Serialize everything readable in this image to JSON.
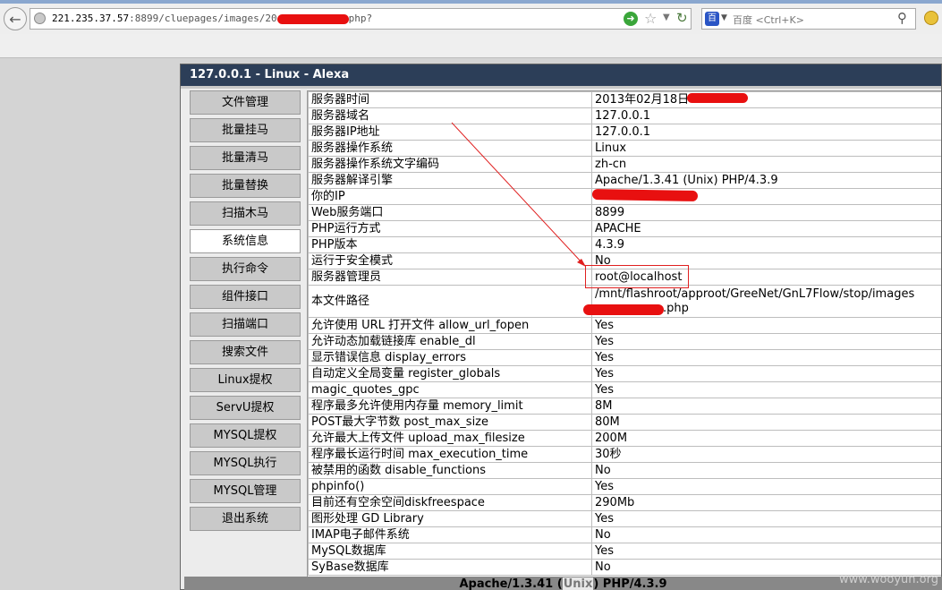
{
  "browser": {
    "url_host": "221.235.37.57",
    "url_rest_before": ":8899/cluepages/images/20",
    "url_rest_after": "php?",
    "search_placeholder": "百度 <Ctrl+K>",
    "search_engine_label": "百",
    "icons": {
      "back": "back-arrow-icon",
      "go": "go-arrow-icon",
      "bookmark": "star-icon",
      "reload": "reload-icon",
      "search": "magnifier-icon"
    }
  },
  "panel": {
    "title": "127.0.0.1 - Linux - Alexa"
  },
  "nav": [
    {
      "label": "文件管理",
      "active": false
    },
    {
      "label": "批量挂马",
      "active": false
    },
    {
      "label": "批量清马",
      "active": false
    },
    {
      "label": "批量替换",
      "active": false
    },
    {
      "label": "扫描木马",
      "active": false
    },
    {
      "label": "系统信息",
      "active": true
    },
    {
      "label": "执行命令",
      "active": false
    },
    {
      "label": "组件接口",
      "active": false
    },
    {
      "label": "扫描端口",
      "active": false
    },
    {
      "label": "搜索文件",
      "active": false
    },
    {
      "label": "Linux提权",
      "active": false
    },
    {
      "label": "ServU提权",
      "active": false
    },
    {
      "label": "MYSQL提权",
      "active": false
    },
    {
      "label": "MYSQL执行",
      "active": false
    },
    {
      "label": "MYSQL管理",
      "active": false
    },
    {
      "label": "退出系统",
      "active": false
    }
  ],
  "info": [
    {
      "k": "服务器时间",
      "v": "2013年02月18日"
    },
    {
      "k": "服务器域名",
      "v": "127.0.0.1"
    },
    {
      "k": "服务器IP地址",
      "v": "127.0.0.1"
    },
    {
      "k": "服务器操作系统",
      "v": "Linux"
    },
    {
      "k": "服务器操作系统文字编码",
      "v": "zh-cn"
    },
    {
      "k": "服务器解译引擎",
      "v": "Apache/1.3.41 (Unix) PHP/4.3.9"
    },
    {
      "k": "你的IP",
      "v": ""
    },
    {
      "k": "Web服务端口",
      "v": "8899"
    },
    {
      "k": "PHP运行方式",
      "v": "APACHE"
    },
    {
      "k": "PHP版本",
      "v": "4.3.9"
    },
    {
      "k": "运行于安全模式",
      "v": "No"
    },
    {
      "k": "服务器管理员",
      "v": "root@localhost"
    },
    {
      "k": "本文件路径",
      "v": "/mnt/flashroot/approot/GreeNet/GnL7Flow/stop/images",
      "v2": ".php"
    },
    {
      "k": "允许使用 URL 打开文件 allow_url_fopen",
      "v": "Yes"
    },
    {
      "k": "允许动态加载链接库 enable_dl",
      "v": "Yes"
    },
    {
      "k": "显示错误信息 display_errors",
      "v": "Yes"
    },
    {
      "k": "自动定义全局变量 register_globals",
      "v": "Yes"
    },
    {
      "k": "magic_quotes_gpc",
      "v": "Yes"
    },
    {
      "k": "程序最多允许使用内存量 memory_limit",
      "v": "8M"
    },
    {
      "k": "POST最大字节数 post_max_size",
      "v": "80M"
    },
    {
      "k": "允许最大上传文件 upload_max_filesize",
      "v": "200M"
    },
    {
      "k": "程序最长运行时间 max_execution_time",
      "v": "30秒"
    },
    {
      "k": "被禁用的函数 disable_functions",
      "v": "No"
    },
    {
      "k": "phpinfo()",
      "v": "Yes"
    },
    {
      "k": "目前还有空余空间diskfreespace",
      "v": "290Mb"
    },
    {
      "k": "图形处理 GD Library",
      "v": "Yes"
    },
    {
      "k": "IMAP电子邮件系统",
      "v": "No"
    },
    {
      "k": "MySQL数据库",
      "v": "Yes"
    },
    {
      "k": "SyBase数据库",
      "v": "No"
    }
  ],
  "footer": {
    "before": "Apache/1.3.41 (",
    "highlight": "Unix",
    "after": ") PHP/4.3.9"
  },
  "watermark": "www.wooyun.org",
  "annotation_color": "#e02020"
}
